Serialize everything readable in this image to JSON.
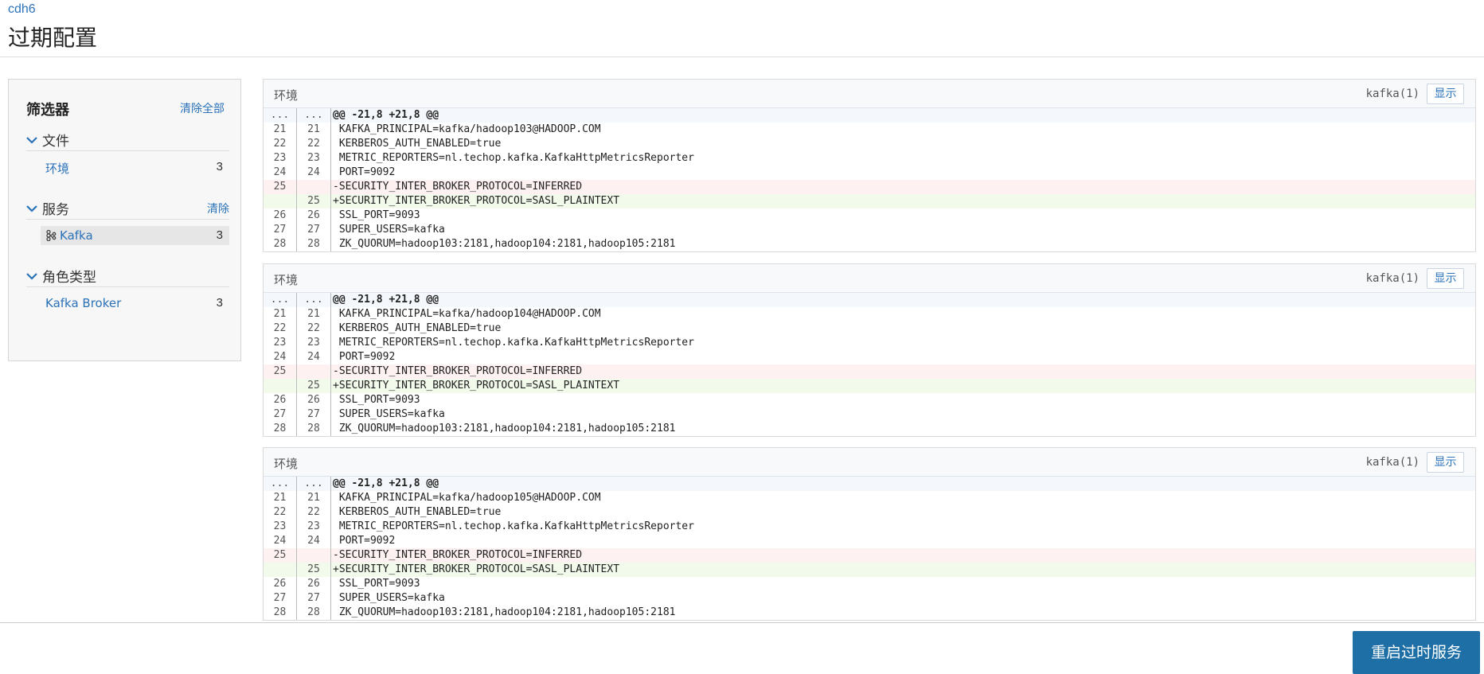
{
  "header": {
    "breadcrumb": "cdh6",
    "title": "过期配置"
  },
  "filter": {
    "title": "筛选器",
    "clear_all": "清除全部",
    "groups": [
      {
        "name": "文件",
        "clear": "",
        "items": [
          {
            "label": "环境",
            "count": "3"
          }
        ]
      },
      {
        "name": "服务",
        "clear": "清除",
        "items": [
          {
            "label": "Kafka",
            "count": "3",
            "icon": "kafka-icon"
          }
        ]
      },
      {
        "name": "角色类型",
        "clear": "",
        "items": [
          {
            "label": "Kafka Broker",
            "count": "3"
          }
        ]
      }
    ]
  },
  "panels": [
    {
      "label": "环境",
      "service": "kafka(1)",
      "show": "显示",
      "rows": [
        {
          "type": "hunk",
          "l1": "...",
          "l2": "...",
          "text": "@@ -21,8 +21,8 @@"
        },
        {
          "type": "ctx",
          "l1": "21",
          "l2": "21",
          "text": " KAFKA_PRINCIPAL=kafka/hadoop103@HADOOP.COM"
        },
        {
          "type": "ctx",
          "l1": "22",
          "l2": "22",
          "text": " KERBEROS_AUTH_ENABLED=true"
        },
        {
          "type": "ctx",
          "l1": "23",
          "l2": "23",
          "text": " METRIC_REPORTERS=nl.techop.kafka.KafkaHttpMetricsReporter"
        },
        {
          "type": "ctx",
          "l1": "24",
          "l2": "24",
          "text": " PORT=9092"
        },
        {
          "type": "del",
          "l1": "25",
          "l2": "",
          "text": "-SECURITY_INTER_BROKER_PROTOCOL=INFERRED"
        },
        {
          "type": "add",
          "l1": "",
          "l2": "25",
          "text": "+SECURITY_INTER_BROKER_PROTOCOL=SASL_PLAINTEXT"
        },
        {
          "type": "ctx",
          "l1": "26",
          "l2": "26",
          "text": " SSL_PORT=9093"
        },
        {
          "type": "ctx",
          "l1": "27",
          "l2": "27",
          "text": " SUPER_USERS=kafka"
        },
        {
          "type": "ctx",
          "l1": "28",
          "l2": "28",
          "text": " ZK_QUORUM=hadoop103:2181,hadoop104:2181,hadoop105:2181"
        }
      ]
    },
    {
      "label": "环境",
      "service": "kafka(1)",
      "show": "显示",
      "rows": [
        {
          "type": "hunk",
          "l1": "...",
          "l2": "...",
          "text": "@@ -21,8 +21,8 @@"
        },
        {
          "type": "ctx",
          "l1": "21",
          "l2": "21",
          "text": " KAFKA_PRINCIPAL=kafka/hadoop104@HADOOP.COM"
        },
        {
          "type": "ctx",
          "l1": "22",
          "l2": "22",
          "text": " KERBEROS_AUTH_ENABLED=true"
        },
        {
          "type": "ctx",
          "l1": "23",
          "l2": "23",
          "text": " METRIC_REPORTERS=nl.techop.kafka.KafkaHttpMetricsReporter"
        },
        {
          "type": "ctx",
          "l1": "24",
          "l2": "24",
          "text": " PORT=9092"
        },
        {
          "type": "del",
          "l1": "25",
          "l2": "",
          "text": "-SECURITY_INTER_BROKER_PROTOCOL=INFERRED"
        },
        {
          "type": "add",
          "l1": "",
          "l2": "25",
          "text": "+SECURITY_INTER_BROKER_PROTOCOL=SASL_PLAINTEXT"
        },
        {
          "type": "ctx",
          "l1": "26",
          "l2": "26",
          "text": " SSL_PORT=9093"
        },
        {
          "type": "ctx",
          "l1": "27",
          "l2": "27",
          "text": " SUPER_USERS=kafka"
        },
        {
          "type": "ctx",
          "l1": "28",
          "l2": "28",
          "text": " ZK_QUORUM=hadoop103:2181,hadoop104:2181,hadoop105:2181"
        }
      ]
    },
    {
      "label": "环境",
      "service": "kafka(1)",
      "show": "显示",
      "rows": [
        {
          "type": "hunk",
          "l1": "...",
          "l2": "...",
          "text": "@@ -21,8 +21,8 @@"
        },
        {
          "type": "ctx",
          "l1": "21",
          "l2": "21",
          "text": " KAFKA_PRINCIPAL=kafka/hadoop105@HADOOP.COM"
        },
        {
          "type": "ctx",
          "l1": "22",
          "l2": "22",
          "text": " KERBEROS_AUTH_ENABLED=true"
        },
        {
          "type": "ctx",
          "l1": "23",
          "l2": "23",
          "text": " METRIC_REPORTERS=nl.techop.kafka.KafkaHttpMetricsReporter"
        },
        {
          "type": "ctx",
          "l1": "24",
          "l2": "24",
          "text": " PORT=9092"
        },
        {
          "type": "del",
          "l1": "25",
          "l2": "",
          "text": "-SECURITY_INTER_BROKER_PROTOCOL=INFERRED"
        },
        {
          "type": "add",
          "l1": "",
          "l2": "25",
          "text": "+SECURITY_INTER_BROKER_PROTOCOL=SASL_PLAINTEXT"
        },
        {
          "type": "ctx",
          "l1": "26",
          "l2": "26",
          "text": " SSL_PORT=9093"
        },
        {
          "type": "ctx",
          "l1": "27",
          "l2": "27",
          "text": " SUPER_USERS=kafka"
        },
        {
          "type": "ctx",
          "l1": "28",
          "l2": "28",
          "text": " ZK_QUORUM=hadoop103:2181,hadoop104:2181,hadoop105:2181"
        }
      ]
    }
  ],
  "footer": {
    "restart_label": "重启过时服务"
  }
}
